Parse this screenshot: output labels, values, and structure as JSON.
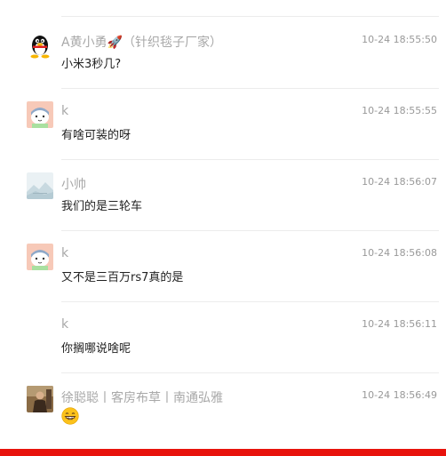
{
  "messages": [
    {
      "avatar": "penguin-avatar",
      "name": "A黄小勇🚀（针织毯子厂家）",
      "time": "10-24 18:55:50",
      "text": "小米3秒几?"
    },
    {
      "avatar": "cartoon-cat-avatar",
      "name": "k",
      "time": "10-24 18:55:55",
      "text": "有啥可装的呀"
    },
    {
      "avatar": "landscape-avatar",
      "name": "小帅",
      "time": "10-24 18:56:07",
      "text": "我们的是三轮车"
    },
    {
      "avatar": "cartoon-cat-avatar",
      "name": "k",
      "time": "10-24 18:56:08",
      "text": "又不是三百万rs7真的是"
    },
    {
      "avatar": "none",
      "name": "k",
      "time": "10-24 18:56:11",
      "text": "你搁哪说啥呢"
    },
    {
      "avatar": "person-photo-avatar",
      "name": "徐聪聪丨客房布草丨南通弘雅",
      "time": "10-24 18:56:49",
      "emoji": "grinning-face-emoji"
    }
  ],
  "colors": {
    "accent_bar": "#e8130d",
    "name": "#a8a8a8",
    "time": "#999999",
    "text": "#222222",
    "divider": "#ececec"
  }
}
